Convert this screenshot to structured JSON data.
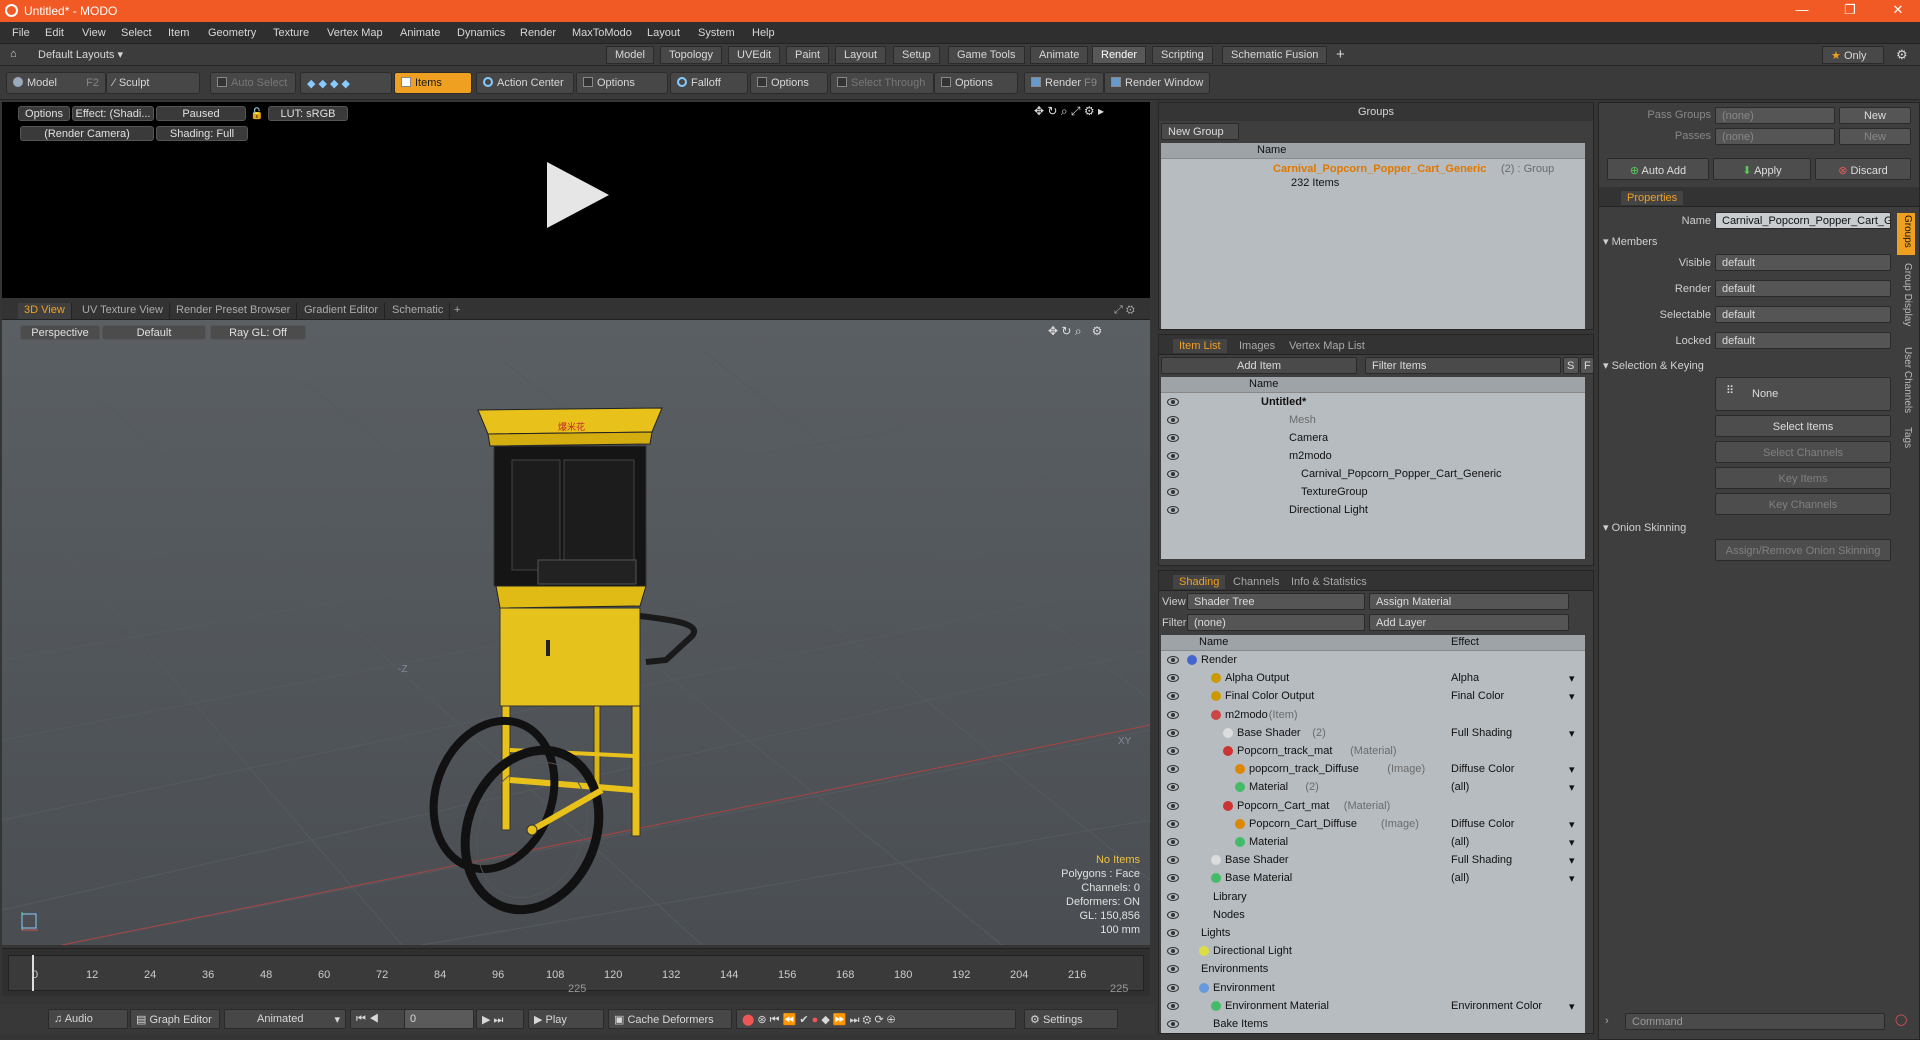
{
  "window": {
    "title": "Untitled* - MODO",
    "minimize": "—",
    "restore": "❐",
    "close": "✕"
  },
  "menu": [
    "File",
    "Edit",
    "View",
    "Select",
    "Item",
    "Geometry",
    "Texture",
    "Vertex Map",
    "Animate",
    "Dynamics",
    "Render",
    "MaxToModo",
    "Layout",
    "System",
    "Help"
  ],
  "layouts": {
    "selector": "Default Layouts",
    "tabs": [
      "Model",
      "Topology",
      "UVEdit",
      "Paint",
      "Layout",
      "Setup",
      "Game Tools",
      "Animate",
      "Render",
      "Scripting",
      "Schematic Fusion"
    ],
    "active": "Render",
    "add": "+",
    "only": "Only"
  },
  "toolbar": {
    "model": "Model",
    "model_key": "F2",
    "sculpt": "Sculpt",
    "auto_select": "Auto Select",
    "items": "Items",
    "action_center": "Action Center",
    "options1": "Options",
    "falloff": "Falloff",
    "options2": "Options",
    "select_through": "Select Through",
    "options3": "Options",
    "render": "Render",
    "render_key": "F9",
    "render_window": "Render Window"
  },
  "render_view": {
    "options": "Options",
    "effect": "Effect: (Shadi...",
    "paused": "Paused",
    "lut": "LUT: sRGB",
    "camera": "(Render Camera)",
    "shading": "Shading: Full"
  },
  "view_tabs": [
    "3D View",
    "UV Texture View",
    "Render Preset Browser",
    "Gradient Editor",
    "Schematic"
  ],
  "viewport": {
    "perspective": "Perspective",
    "default": "Default",
    "raygl": "Ray GL: Off",
    "stats": [
      "No Items",
      "Polygons : Face",
      "Channels: 0",
      "Deformers: ON",
      "GL: 150,856",
      "100 mm"
    ],
    "axis_label": "-Z",
    "sign_label": "XY",
    "cart_sign": "爆米花"
  },
  "timeline": {
    "ticks": [
      "0",
      "12",
      "24",
      "36",
      "48",
      "60",
      "72",
      "84",
      "96",
      "108",
      "120",
      "132",
      "144",
      "156",
      "168",
      "180",
      "192",
      "204",
      "216"
    ],
    "mid": "225",
    "end": "225"
  },
  "bottom": {
    "audio": "Audio",
    "graph_editor": "Graph Editor",
    "animated": "Animated",
    "frame": "0",
    "play": "Play",
    "cache": "Cache Deformers",
    "settings": "Settings"
  },
  "groups": {
    "title": "Groups",
    "new_group": "New Group",
    "col_name": "Name",
    "item_name": "Carnival_Popcorn_Popper_Cart_Generic",
    "item_suffix": "(2) : Group",
    "item_count": "232 Items"
  },
  "item_list": {
    "tabs": [
      "Item List",
      "Images",
      "Vertex Map List"
    ],
    "add_item": "Add Item",
    "filter": "Filter Items",
    "s": "S",
    "f": "F",
    "col_name": "Name",
    "rows": [
      "Untitled*",
      "Mesh",
      "Camera",
      "m2modo",
      "Carnival_Popcorn_Popper_Cart_Generic",
      "TextureGroup",
      "Directional Light"
    ]
  },
  "shading": {
    "tabs": [
      "Shading",
      "Channels",
      "Info & Statistics"
    ],
    "view_label": "View",
    "view_value": "Shader Tree",
    "assign": "Assign Material",
    "filter_label": "Filter",
    "filter_value": "(none)",
    "add_layer": "Add Layer",
    "col_name": "Name",
    "col_effect": "Effect",
    "rows": [
      {
        "name": "Render",
        "sub": "",
        "effect": ""
      },
      {
        "name": "Alpha Output",
        "sub": "",
        "effect": "Alpha"
      },
      {
        "name": "Final Color Output",
        "sub": "",
        "effect": "Final Color"
      },
      {
        "name": "m2modo",
        "sub": "(Item)",
        "effect": ""
      },
      {
        "name": "Base Shader",
        "sub": "(2)",
        "effect": "Full Shading"
      },
      {
        "name": "Popcorn_track_mat",
        "sub": "(Material)",
        "effect": ""
      },
      {
        "name": "popcorn_track_Diffuse",
        "sub": "(Image)",
        "effect": "Diffuse Color"
      },
      {
        "name": "Material",
        "sub": "(2)",
        "effect": "(all)"
      },
      {
        "name": "Popcorn_Cart_mat",
        "sub": "(Material)",
        "effect": ""
      },
      {
        "name": "Popcorn_Cart_Diffuse",
        "sub": "(Image)",
        "effect": "Diffuse Color"
      },
      {
        "name": "Material",
        "sub": "",
        "effect": "(all)"
      },
      {
        "name": "Base Shader",
        "sub": "",
        "effect": "Full Shading"
      },
      {
        "name": "Base Material",
        "sub": "",
        "effect": "(all)"
      },
      {
        "name": "Library",
        "sub": "",
        "effect": ""
      },
      {
        "name": "Nodes",
        "sub": "",
        "effect": ""
      },
      {
        "name": "Lights",
        "sub": "",
        "effect": ""
      },
      {
        "name": "Directional Light",
        "sub": "",
        "effect": ""
      },
      {
        "name": "Environments",
        "sub": "",
        "effect": ""
      },
      {
        "name": "Environment",
        "sub": "",
        "effect": ""
      },
      {
        "name": "Environment Material",
        "sub": "",
        "effect": "Environment Color"
      },
      {
        "name": "Bake Items",
        "sub": "",
        "effect": ""
      }
    ]
  },
  "properties": {
    "pass_groups": "Pass Groups",
    "pass_groups_val": "(none)",
    "passes": "Passes",
    "passes_val": "(none)",
    "new": "New",
    "auto_add": "Auto Add",
    "apply": "Apply",
    "discard": "Discard",
    "tab": "Properties",
    "name_label": "Name",
    "name_value": "Carnival_Popcorn_Popper_Cart_Ge",
    "members": "Members",
    "fields": [
      {
        "label": "Visible",
        "value": "default"
      },
      {
        "label": "Render",
        "value": "default"
      },
      {
        "label": "Selectable",
        "value": "default"
      },
      {
        "label": "Locked",
        "value": "default"
      }
    ],
    "selection_keying": "Selection & Keying",
    "none": "None",
    "select_items": "Select Items",
    "select_channels": "Select Channels",
    "key_items": "Key Items",
    "key_channels": "Key Channels",
    "onion": "Onion Skinning",
    "assign_onion": "Assign/Remove Onion Skinning",
    "side_tabs": [
      "Groups",
      "Group Display",
      "User Channels",
      "Tags"
    ],
    "command": "Command"
  }
}
